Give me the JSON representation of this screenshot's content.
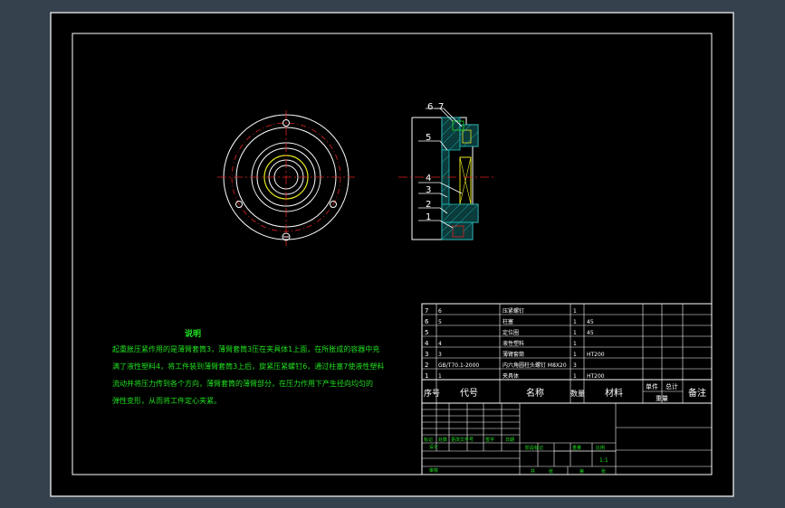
{
  "drawing": {
    "colors": {
      "background": "#35414c",
      "sheet": "#000000",
      "frame": "#ffffff",
      "note_text": "#20e020",
      "bom_text": "#ffffff",
      "highlight": "#e6e620",
      "hatch": "#20c0c0",
      "center_line": "#e02020"
    },
    "callouts": {
      "c1": "1",
      "c2": "2",
      "c3": "3",
      "c4": "4",
      "c5": "5",
      "c6": "6",
      "c7": "7"
    },
    "notes": {
      "title": "说明",
      "lines": [
        "起重胀压紧作用的是薄臂套筒3，薄臂套筒3压在夹具体1上面，在所胀成的容器中充",
        "满了液性塑料4，将工件装到薄臂套筒3上后，旋紧压紧螺钉6，通过柱塞7使液性塑料",
        "流动并将压力传到各个方向，薄臂套筒的薄臂部分，在压力作用下产生径向均匀的",
        "弹性变形，从而将工件定心夹紧。"
      ]
    },
    "bom": {
      "header": {
        "seq": "序号",
        "code": "代号",
        "name": "名称",
        "qty": "数量",
        "material": "材料",
        "unit_weight": "单件",
        "total_weight": "总计",
        "weight": "重量",
        "remark": "备注"
      },
      "rows": [
        {
          "seq": "7",
          "code": "6",
          "name": "压紧螺钉",
          "qty": "1",
          "material": ""
        },
        {
          "seq": "6",
          "code": "5",
          "name": "柱塞",
          "qty": "1",
          "material": "45"
        },
        {
          "seq": "5",
          "code": "",
          "name": "定位圈",
          "qty": "1",
          "material": "45"
        },
        {
          "seq": "4",
          "code": "4",
          "name": "液性塑料",
          "qty": "1",
          "material": ""
        },
        {
          "seq": "3",
          "code": "3",
          "name": "薄臂套筒",
          "qty": "1",
          "material": "HT200"
        },
        {
          "seq": "2",
          "code": "GB/T70.1-2000",
          "name": "内六角圆柱头螺钉 M8X20",
          "qty": "3",
          "material": ""
        },
        {
          "seq": "1",
          "code": "1",
          "name": "夹具体",
          "qty": "1",
          "material": "HT200"
        }
      ]
    },
    "title_block": {
      "mark": "标记",
      "zone": "处数",
      "change_doc": "更改文件号",
      "signature": "签字",
      "date": "日期",
      "design": "设计",
      "review": "审核",
      "stage_mark": "阶段标记",
      "weight": "重量",
      "scale_label": "比例",
      "scale": "1:1",
      "sheets": "共",
      "sheet": "第",
      "sheet_unit": "张"
    }
  }
}
